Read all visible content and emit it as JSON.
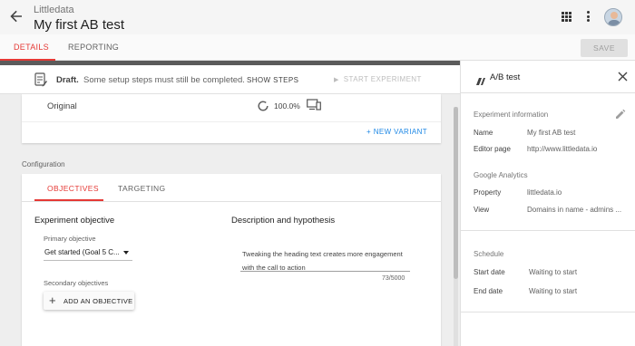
{
  "header": {
    "app_name": "Littledata",
    "title": "My first AB test",
    "icons": [
      "back-arrow-icon",
      "apps-grid-icon",
      "more-vert-icon",
      "avatar"
    ]
  },
  "tabs": [
    {
      "label": "DETAILS",
      "active": true
    },
    {
      "label": "REPORTING",
      "active": false
    }
  ],
  "save_label": "SAVE",
  "banner": {
    "status": "Draft.",
    "message": "Some setup steps must still be completed.",
    "show_steps": "SHOW STEPS",
    "start_experiment": "START EXPERIMENT"
  },
  "variants": {
    "items": [
      {
        "name": "Original",
        "percent": "100.0%"
      }
    ],
    "new_variant": "+ NEW VARIANT"
  },
  "configuration": {
    "label": "Configuration",
    "tabs": [
      {
        "label": "OBJECTIVES",
        "active": true
      },
      {
        "label": "TARGETING",
        "active": false
      }
    ],
    "objective_heading": "Experiment objective",
    "primary_label": "Primary objective",
    "primary_value": "Get started (Goal 5 C...",
    "secondary_label": "Secondary objectives",
    "add_objective": "ADD AN OBJECTIVE",
    "description_heading": "Description and hypothesis",
    "description_text": "Tweaking the heading text creates more engagement with the call to action",
    "char_count": "73/5000"
  },
  "panel": {
    "title": "A/B test",
    "experiment_info": {
      "heading": "Experiment information",
      "rows": [
        {
          "key": "Name",
          "value": "My first AB test"
        },
        {
          "key": "Editor page",
          "value": "http://www.littledata.io"
        }
      ]
    },
    "google_analytics": {
      "heading": "Google Analytics",
      "rows": [
        {
          "key": "Property",
          "value": "littledata.io"
        },
        {
          "key": "View",
          "value": "Domains in name - admins ..."
        }
      ]
    },
    "schedule": {
      "heading": "Schedule",
      "rows": [
        {
          "key": "Start date",
          "value": "Waiting to start"
        },
        {
          "key": "End date",
          "value": "Waiting to start"
        }
      ]
    }
  },
  "colors": {
    "accent": "#e53935",
    "link": "#1e88e5",
    "disabled": "#bdbdbd"
  }
}
